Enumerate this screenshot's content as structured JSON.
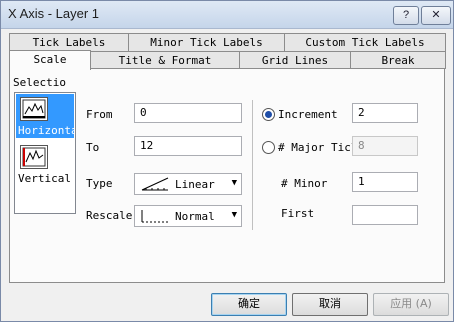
{
  "window": {
    "title": "X Axis - Layer 1",
    "help_label": "?",
    "close_label": "✕"
  },
  "tabs": {
    "row_back": [
      "Tick Labels",
      "Minor Tick Labels",
      "Custom Tick Labels"
    ],
    "row_front": [
      "Scale",
      "Title & Format",
      "Grid Lines",
      "Break"
    ],
    "active": "Scale"
  },
  "selection": {
    "label": "Selectio",
    "items": [
      {
        "label": "Horizonta",
        "icon": "horizontal-axis-icon",
        "selected": true
      },
      {
        "label": "Vertical",
        "icon": "vertical-axis-icon",
        "selected": false
      }
    ]
  },
  "scale": {
    "from_label": "From",
    "from_value": "0",
    "to_label": "To",
    "to_value": "12",
    "type_label": "Type",
    "type_value": "Linear",
    "rescale_label": "Rescale",
    "rescale_value": "Normal"
  },
  "ticks": {
    "increment_label": "Increment",
    "increment_value": "2",
    "increment_selected": true,
    "major_label": "# Major Ticl",
    "major_value": "8",
    "minor_label": "# Minor",
    "minor_value": "1",
    "first_label": "First",
    "first_value": ""
  },
  "buttons": {
    "ok": "确定",
    "cancel": "取消",
    "apply": "应用 (A)"
  }
}
